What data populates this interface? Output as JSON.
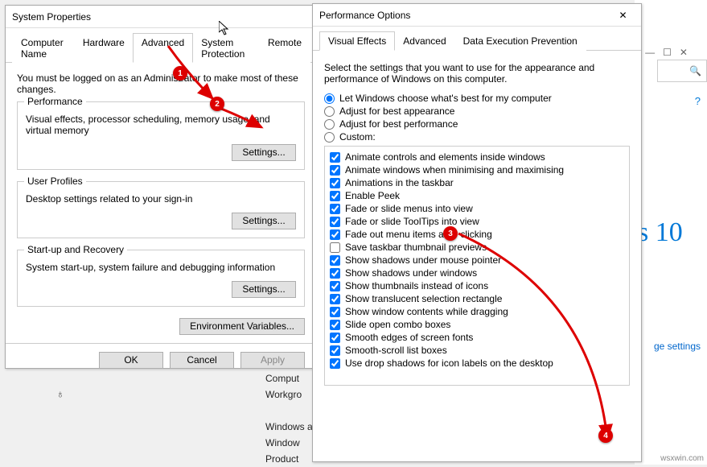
{
  "bg": {
    "win10": "s 10",
    "link": "ge settings",
    "watermark": "wsxwin.com"
  },
  "sys": {
    "title": "System Properties",
    "tabs": [
      "Computer Name",
      "Hardware",
      "Advanced",
      "System Protection",
      "Remote"
    ],
    "intro": "You must be logged on as an Administrator to make most of these changes.",
    "perf": {
      "title": "Performance",
      "text": "Visual effects, processor scheduling, memory usage, and virtual memory",
      "settings": "Settings..."
    },
    "user": {
      "title": "User Profiles",
      "text": "Desktop settings related to your sign-in",
      "settings": "Settings..."
    },
    "startup": {
      "title": "Start-up and Recovery",
      "text": "System start-up, system failure and debugging information",
      "settings": "Settings..."
    },
    "env": "Environment Variables...",
    "ok": "OK",
    "cancel": "Cancel",
    "apply": "Apply"
  },
  "info": {
    "comp": "Comput",
    "work": "Workgro",
    "act": "Windows ac",
    "win": "Window",
    "prod": "Product"
  },
  "perf": {
    "title": "Performance Options",
    "tabs": [
      "Visual Effects",
      "Advanced",
      "Data Execution Prevention"
    ],
    "intro": "Select the settings that you want to use for the appearance and performance of Windows on this computer.",
    "r1": "Let Windows choose what's best for my computer",
    "r2": "Adjust for best appearance",
    "r3": "Adjust for best performance",
    "r4": "Custom:",
    "items": [
      {
        "c": true,
        "l": "Animate controls and elements inside windows"
      },
      {
        "c": true,
        "l": "Animate windows when minimising and maximising"
      },
      {
        "c": true,
        "l": "Animations in the taskbar"
      },
      {
        "c": true,
        "l": "Enable Peek"
      },
      {
        "c": true,
        "l": "Fade or slide menus into view"
      },
      {
        "c": true,
        "l": "Fade or slide ToolTips into view"
      },
      {
        "c": true,
        "l": "Fade out menu items after clicking"
      },
      {
        "c": false,
        "l": "Save taskbar thumbnail previews"
      },
      {
        "c": true,
        "l": "Show shadows under mouse pointer"
      },
      {
        "c": true,
        "l": "Show shadows under windows"
      },
      {
        "c": true,
        "l": "Show thumbnails instead of icons"
      },
      {
        "c": true,
        "l": "Show translucent selection rectangle"
      },
      {
        "c": true,
        "l": "Show window contents while dragging"
      },
      {
        "c": true,
        "l": "Slide open combo boxes"
      },
      {
        "c": true,
        "l": "Smooth edges of screen fonts"
      },
      {
        "c": true,
        "l": "Smooth-scroll list boxes"
      },
      {
        "c": true,
        "l": "Use drop shadows for icon labels on the desktop"
      }
    ]
  }
}
